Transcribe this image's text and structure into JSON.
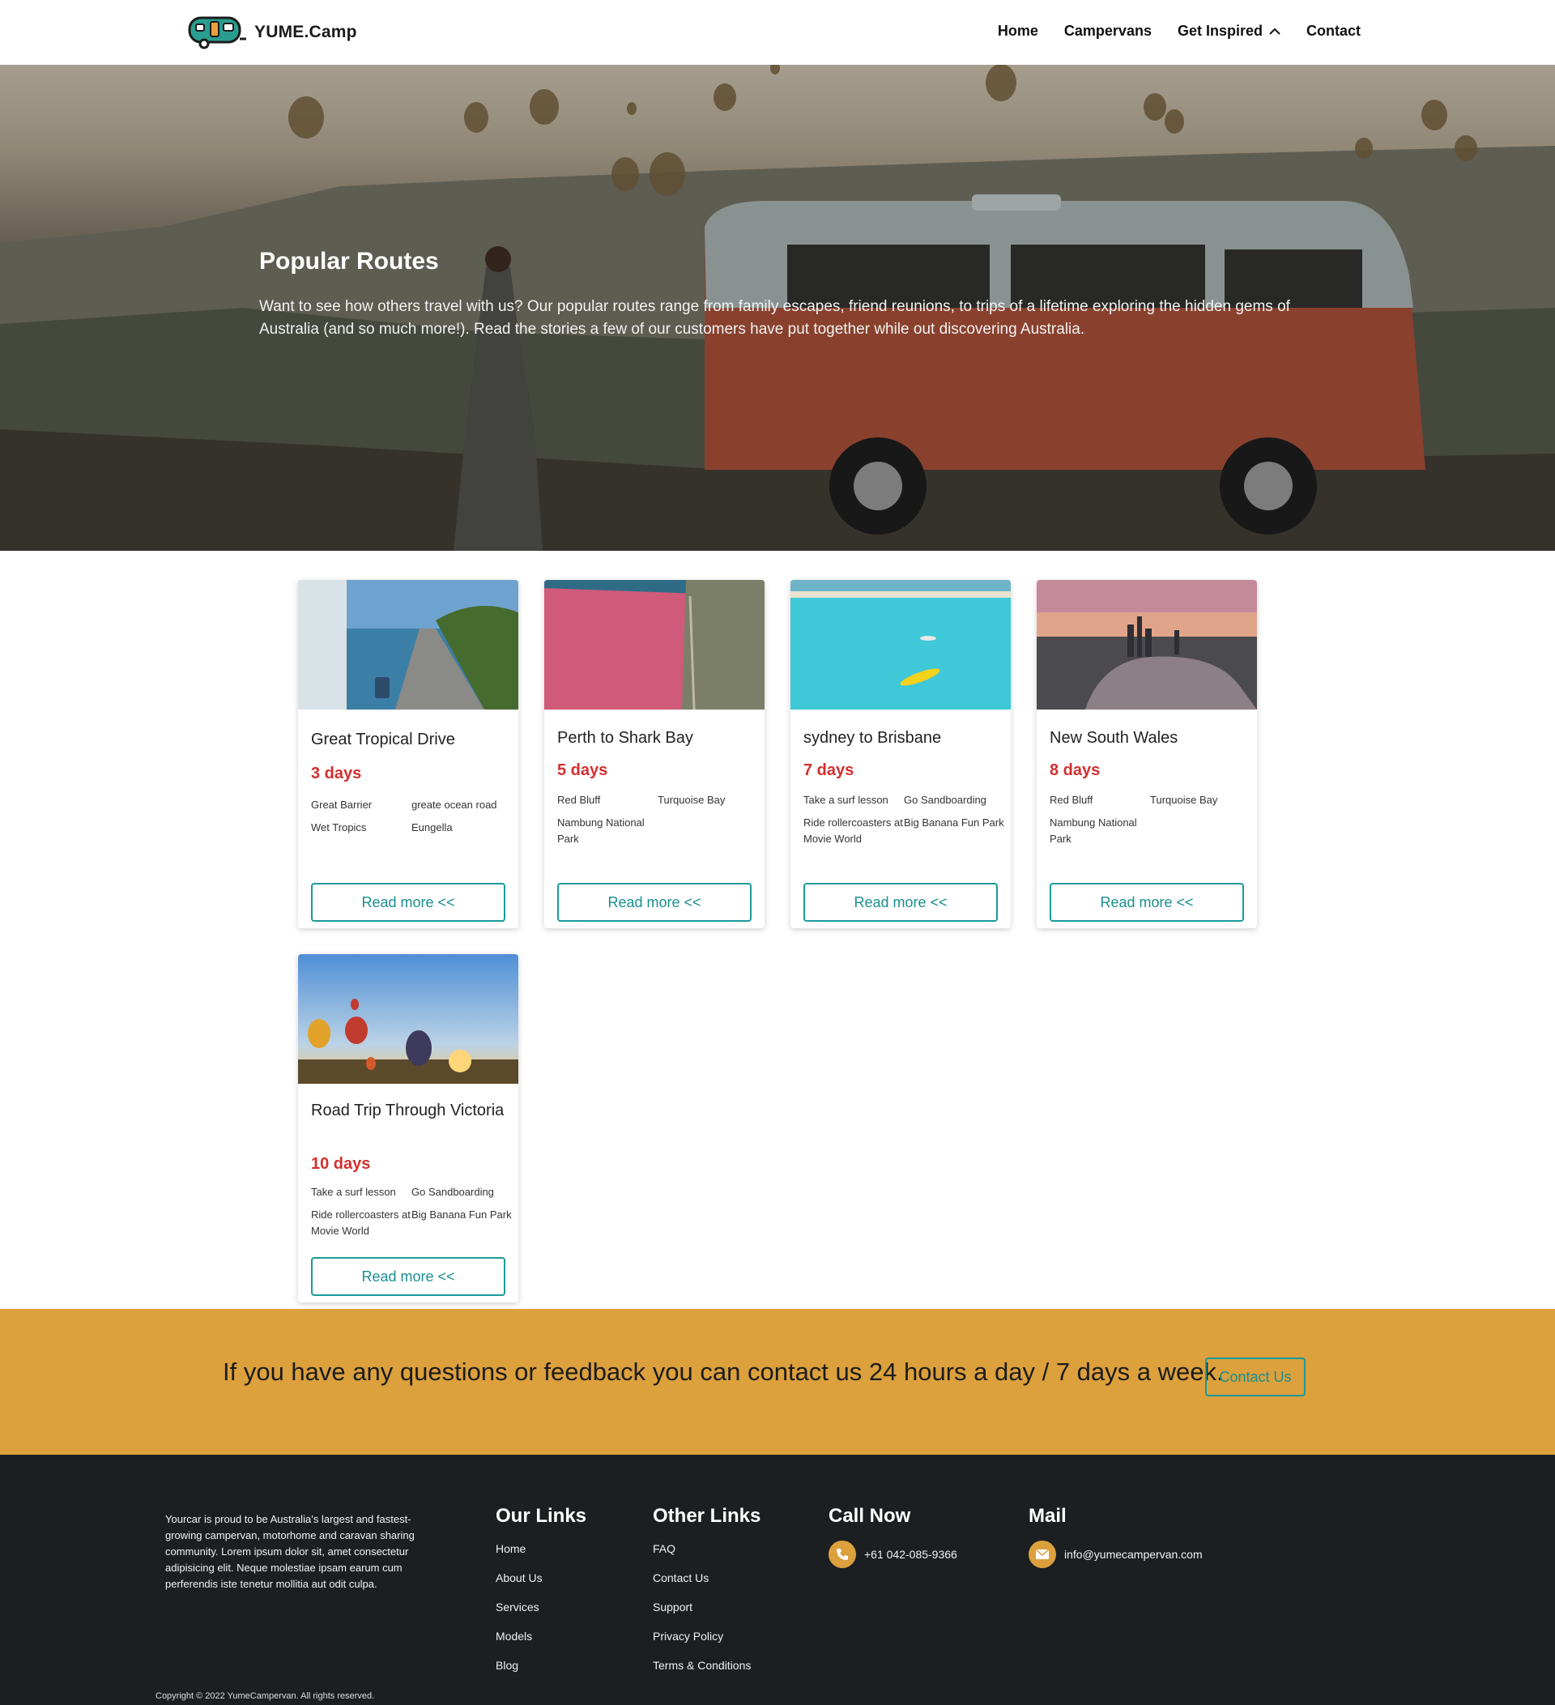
{
  "brand": {
    "name": "YUME.Camp",
    "accent": "#1a9a9a",
    "highlight": "#dca03c",
    "days_color": "#d32f2f"
  },
  "nav": {
    "items": [
      {
        "label": "Home"
      },
      {
        "label": "Campervans"
      },
      {
        "label": "Get Inspired",
        "icon": "chevron-up-icon"
      },
      {
        "label": "Contact"
      }
    ]
  },
  "hero": {
    "title": "Popular Routes",
    "text": "Want to see how others travel with us? Our popular routes range from family escapes, friend reunions, to trips of a lifetime exploring the hidden gems of Australia (and so much more!). Read the stories a few of our customers have put together while out discovering Australia."
  },
  "cards": [
    {
      "title": "Great Tropical Drive",
      "days": "3 days",
      "stops": [
        "Great Barrier",
        "greate ocean road",
        "Wet Tropics",
        "Eungella"
      ],
      "button": "Read more <<",
      "image": "coastal-road-image"
    },
    {
      "title": "Perth to Shark Bay",
      "days": "5 days",
      "stops": [
        "Red Bluff",
        "Turquoise Bay",
        "Nambung National Park"
      ],
      "button": "Read more <<",
      "image": "pink-lake-image"
    },
    {
      "title": "sydney to Brisbane",
      "days": "7 days",
      "stops": [
        "Take a surf lesson",
        "Go Sandboarding",
        "Ride rollercoasters at Movie World",
        "Big Banana Fun Park"
      ],
      "button": "Read more <<",
      "image": "kayak-sea-image"
    },
    {
      "title": "New South Wales",
      "days": "8 days",
      "stops": [
        "Red Bluff",
        "Turquoise Bay",
        "Nambung National Park"
      ],
      "button": "Read more <<",
      "image": "city-river-image"
    },
    {
      "title": "Road Trip Through Victoria",
      "days": "10 days",
      "stops": [
        "Take a surf lesson",
        "Go Sandboarding",
        "Ride rollercoasters at Movie World",
        "Big Banana Fun Park"
      ],
      "button": "Read more <<",
      "image": "balloons-sunset-image"
    }
  ],
  "banner": {
    "text": "If you have any questions or feedback you can contact us 24 hours a day / 7 days a week.",
    "button": "Contact Us"
  },
  "footer": {
    "about": "Yourcar is proud to be Australia’s largest and fastest-growing campervan, motorhome and caravan sharing community. Lorem ipsum dolor sit, amet consectetur adipisicing elit. Neque molestiae ipsam earum cum perferendis iste tenetur mollitia aut odit culpa.",
    "our_links": {
      "title": "Our Links",
      "items": [
        "Home",
        "About Us",
        "Services",
        "Models",
        "Blog"
      ]
    },
    "other_links": {
      "title": "Other Links",
      "items": [
        "FAQ",
        "Contact Us",
        "Support",
        "Privacy Policy",
        "Terms & Conditions"
      ]
    },
    "call": {
      "title": "Call Now",
      "phone": "+61 042-085-9366",
      "icon": "phone-icon"
    },
    "mail": {
      "title": "Mail",
      "email": "info@yumecampervan.com",
      "icon": "mail-icon"
    },
    "copyright": "Copyright © 2022 YumeCampervan. All rights reserved."
  }
}
